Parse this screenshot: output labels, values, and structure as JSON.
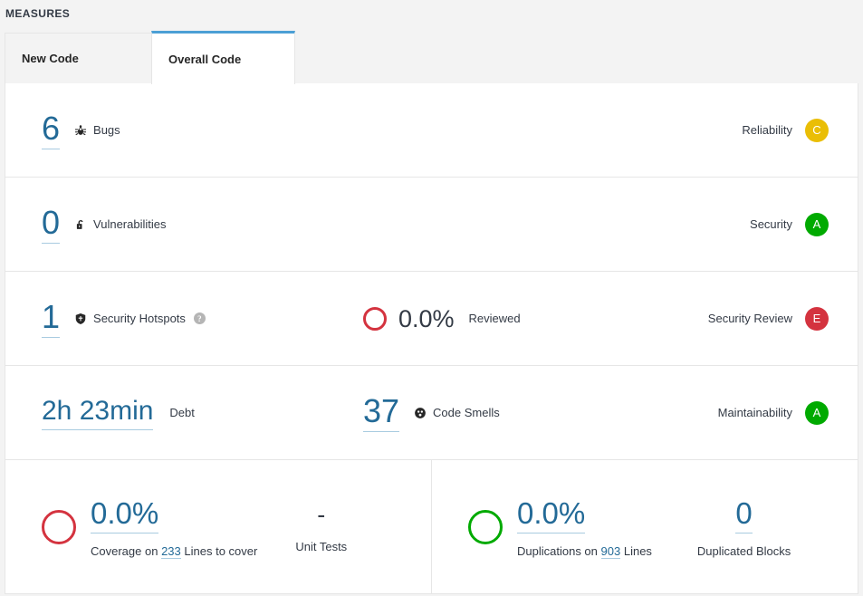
{
  "section": {
    "title": "MEASURES"
  },
  "tabs": [
    {
      "label": "New Code",
      "active": false
    },
    {
      "label": "Overall Code",
      "active": true
    }
  ],
  "colors": {
    "link": "#236a97",
    "rating_a": "#00aa00",
    "rating_c": "#eabe06",
    "rating_e": "#d4333f",
    "tab_accent": "#4b9fd5"
  },
  "rows": {
    "bugs": {
      "value": "6",
      "label": "Bugs",
      "icon": "bug-icon",
      "rating_name": "Reliability",
      "rating_letter": "C",
      "rating_color": "#eabe06"
    },
    "vulnerabilities": {
      "value": "0",
      "label": "Vulnerabilities",
      "icon": "open-padlock-icon",
      "rating_name": "Security",
      "rating_letter": "A",
      "rating_color": "#00aa00"
    },
    "hotspots": {
      "value": "1",
      "label": "Security Hotspots",
      "icon": "shield-icon",
      "help_icon": "help-icon",
      "help_glyph": "?",
      "reviewed_percent": "0.0%",
      "reviewed_label": "Reviewed",
      "reviewed_ring_color": "#d4333f",
      "rating_name": "Security Review",
      "rating_letter": "E",
      "rating_color": "#d4333f"
    },
    "maintainability": {
      "debt_value": "2h 23min",
      "debt_label": "Debt",
      "smells_value": "37",
      "smells_label": "Code Smells",
      "smells_icon": "code-smell-icon",
      "rating_name": "Maintainability",
      "rating_letter": "A",
      "rating_color": "#00aa00"
    }
  },
  "coverage": {
    "percent": "0.0%",
    "ring_color": "#d4333f",
    "caption_prefix": "Coverage on",
    "lines_to_cover": "233",
    "caption_suffix": "Lines to cover",
    "unit_tests_value": "-",
    "unit_tests_label": "Unit Tests"
  },
  "duplications": {
    "percent": "0.0%",
    "ring_color": "#00aa00",
    "caption_prefix": "Duplications on",
    "lines": "903",
    "caption_suffix": "Lines",
    "blocks_value": "0",
    "blocks_label": "Duplicated Blocks"
  }
}
